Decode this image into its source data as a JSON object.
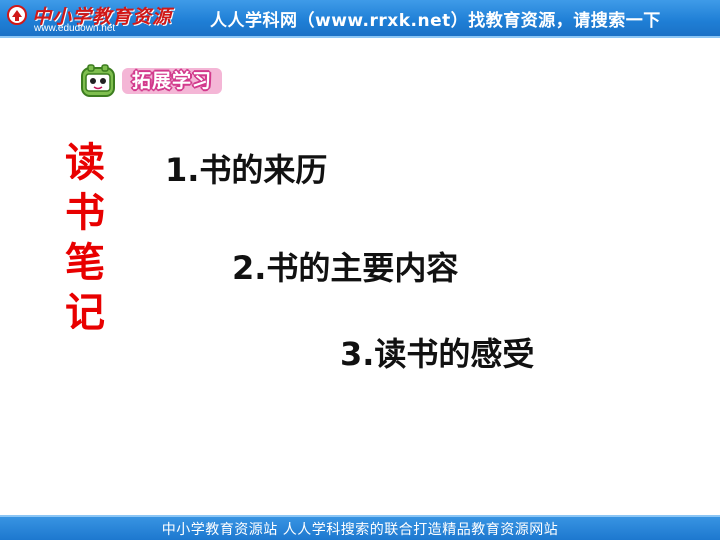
{
  "header": {
    "logo_text": "中小学教育资源",
    "logo_url": "www.edudown.net",
    "banner_text": "人人学科网（www.rrxk.net）找教育资源，请搜索一下"
  },
  "section": {
    "badge_label": "拓展学习",
    "badge_icon": "book-mascot-icon"
  },
  "vertical_title": {
    "chars": [
      "读",
      "书",
      "笔",
      "记"
    ]
  },
  "items": [
    "1.书的来历",
    "2.书的主要内容",
    "3.读书的感受"
  ],
  "footer": {
    "text": "中小学教育资源站  人人学科搜索的联合打造精品教育资源网站"
  },
  "colors": {
    "banner": "#1f7fd6",
    "title_red": "#e80000",
    "item_text": "#111111",
    "badge_pink": "#d23a8c"
  }
}
